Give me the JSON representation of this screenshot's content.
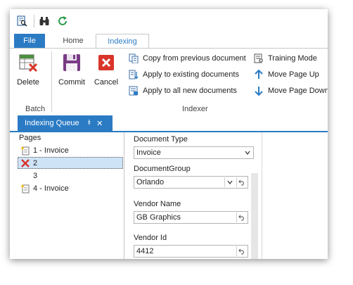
{
  "qat": {
    "icons": [
      "search-doc-icon",
      "binoculars-icon",
      "refresh-icon"
    ]
  },
  "tabs": {
    "file": "File",
    "home": "Home",
    "indexing": "Indexing"
  },
  "ribbon": {
    "delete": "Delete",
    "commit": "Commit",
    "cancel": "Cancel",
    "copy_prev": "Copy from previous document",
    "apply_existing": "Apply to existing documents",
    "apply_new": "Apply to all new documents",
    "training": "Training Mode",
    "move_up": "Move Page Up",
    "move_down": "Move Page Down",
    "group_batch": "Batch",
    "group_indexer": "Indexer"
  },
  "panel": {
    "tab_label": "Indexing Queue",
    "pin": "⯒",
    "close": "✕"
  },
  "pages": {
    "header": "Pages",
    "items": [
      {
        "label": "1 - Invoice",
        "icon": "document-new-icon"
      },
      {
        "label": "2",
        "icon": "red-x-icon"
      },
      {
        "label": "3",
        "icon": ""
      },
      {
        "label": "4 - Invoice",
        "icon": "document-new-icon"
      }
    ]
  },
  "form": {
    "doc_type_label": "Document Type",
    "doc_type_value": "Invoice",
    "doc_group_label": "DocumentGroup",
    "doc_group_value": "Orlando",
    "vendor_name_label": "Vendor Name",
    "vendor_name_value": "GB Graphics",
    "vendor_id_label": "Vendor Id",
    "vendor_id_value": "4412"
  },
  "colors": {
    "accent": "#2b7bc4",
    "selected_row": "#cfe3f7",
    "delete_red": "#d9352a"
  }
}
